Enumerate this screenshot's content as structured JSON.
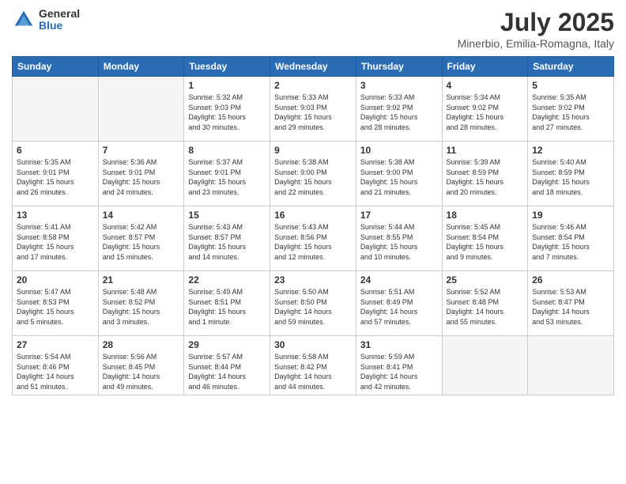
{
  "logo": {
    "general": "General",
    "blue": "Blue"
  },
  "title": "July 2025",
  "subtitle": "Minerbio, Emilia-Romagna, Italy",
  "days_of_week": [
    "Sunday",
    "Monday",
    "Tuesday",
    "Wednesday",
    "Thursday",
    "Friday",
    "Saturday"
  ],
  "weeks": [
    [
      {
        "day": "",
        "info": ""
      },
      {
        "day": "",
        "info": ""
      },
      {
        "day": "1",
        "info": "Sunrise: 5:32 AM\nSunset: 9:03 PM\nDaylight: 15 hours\nand 30 minutes."
      },
      {
        "day": "2",
        "info": "Sunrise: 5:33 AM\nSunset: 9:03 PM\nDaylight: 15 hours\nand 29 minutes."
      },
      {
        "day": "3",
        "info": "Sunrise: 5:33 AM\nSunset: 9:02 PM\nDaylight: 15 hours\nand 28 minutes."
      },
      {
        "day": "4",
        "info": "Sunrise: 5:34 AM\nSunset: 9:02 PM\nDaylight: 15 hours\nand 28 minutes."
      },
      {
        "day": "5",
        "info": "Sunrise: 5:35 AM\nSunset: 9:02 PM\nDaylight: 15 hours\nand 27 minutes."
      }
    ],
    [
      {
        "day": "6",
        "info": "Sunrise: 5:35 AM\nSunset: 9:01 PM\nDaylight: 15 hours\nand 26 minutes."
      },
      {
        "day": "7",
        "info": "Sunrise: 5:36 AM\nSunset: 9:01 PM\nDaylight: 15 hours\nand 24 minutes."
      },
      {
        "day": "8",
        "info": "Sunrise: 5:37 AM\nSunset: 9:01 PM\nDaylight: 15 hours\nand 23 minutes."
      },
      {
        "day": "9",
        "info": "Sunrise: 5:38 AM\nSunset: 9:00 PM\nDaylight: 15 hours\nand 22 minutes."
      },
      {
        "day": "10",
        "info": "Sunrise: 5:38 AM\nSunset: 9:00 PM\nDaylight: 15 hours\nand 21 minutes."
      },
      {
        "day": "11",
        "info": "Sunrise: 5:39 AM\nSunset: 8:59 PM\nDaylight: 15 hours\nand 20 minutes."
      },
      {
        "day": "12",
        "info": "Sunrise: 5:40 AM\nSunset: 8:59 PM\nDaylight: 15 hours\nand 18 minutes."
      }
    ],
    [
      {
        "day": "13",
        "info": "Sunrise: 5:41 AM\nSunset: 8:58 PM\nDaylight: 15 hours\nand 17 minutes."
      },
      {
        "day": "14",
        "info": "Sunrise: 5:42 AM\nSunset: 8:57 PM\nDaylight: 15 hours\nand 15 minutes."
      },
      {
        "day": "15",
        "info": "Sunrise: 5:43 AM\nSunset: 8:57 PM\nDaylight: 15 hours\nand 14 minutes."
      },
      {
        "day": "16",
        "info": "Sunrise: 5:43 AM\nSunset: 8:56 PM\nDaylight: 15 hours\nand 12 minutes."
      },
      {
        "day": "17",
        "info": "Sunrise: 5:44 AM\nSunset: 8:55 PM\nDaylight: 15 hours\nand 10 minutes."
      },
      {
        "day": "18",
        "info": "Sunrise: 5:45 AM\nSunset: 8:54 PM\nDaylight: 15 hours\nand 9 minutes."
      },
      {
        "day": "19",
        "info": "Sunrise: 5:46 AM\nSunset: 8:54 PM\nDaylight: 15 hours\nand 7 minutes."
      }
    ],
    [
      {
        "day": "20",
        "info": "Sunrise: 5:47 AM\nSunset: 8:53 PM\nDaylight: 15 hours\nand 5 minutes."
      },
      {
        "day": "21",
        "info": "Sunrise: 5:48 AM\nSunset: 8:52 PM\nDaylight: 15 hours\nand 3 minutes."
      },
      {
        "day": "22",
        "info": "Sunrise: 5:49 AM\nSunset: 8:51 PM\nDaylight: 15 hours\nand 1 minute."
      },
      {
        "day": "23",
        "info": "Sunrise: 5:50 AM\nSunset: 8:50 PM\nDaylight: 14 hours\nand 59 minutes."
      },
      {
        "day": "24",
        "info": "Sunrise: 5:51 AM\nSunset: 8:49 PM\nDaylight: 14 hours\nand 57 minutes."
      },
      {
        "day": "25",
        "info": "Sunrise: 5:52 AM\nSunset: 8:48 PM\nDaylight: 14 hours\nand 55 minutes."
      },
      {
        "day": "26",
        "info": "Sunrise: 5:53 AM\nSunset: 8:47 PM\nDaylight: 14 hours\nand 53 minutes."
      }
    ],
    [
      {
        "day": "27",
        "info": "Sunrise: 5:54 AM\nSunset: 8:46 PM\nDaylight: 14 hours\nand 51 minutes."
      },
      {
        "day": "28",
        "info": "Sunrise: 5:56 AM\nSunset: 8:45 PM\nDaylight: 14 hours\nand 49 minutes."
      },
      {
        "day": "29",
        "info": "Sunrise: 5:57 AM\nSunset: 8:44 PM\nDaylight: 14 hours\nand 46 minutes."
      },
      {
        "day": "30",
        "info": "Sunrise: 5:58 AM\nSunset: 8:42 PM\nDaylight: 14 hours\nand 44 minutes."
      },
      {
        "day": "31",
        "info": "Sunrise: 5:59 AM\nSunset: 8:41 PM\nDaylight: 14 hours\nand 42 minutes."
      },
      {
        "day": "",
        "info": ""
      },
      {
        "day": "",
        "info": ""
      }
    ]
  ]
}
